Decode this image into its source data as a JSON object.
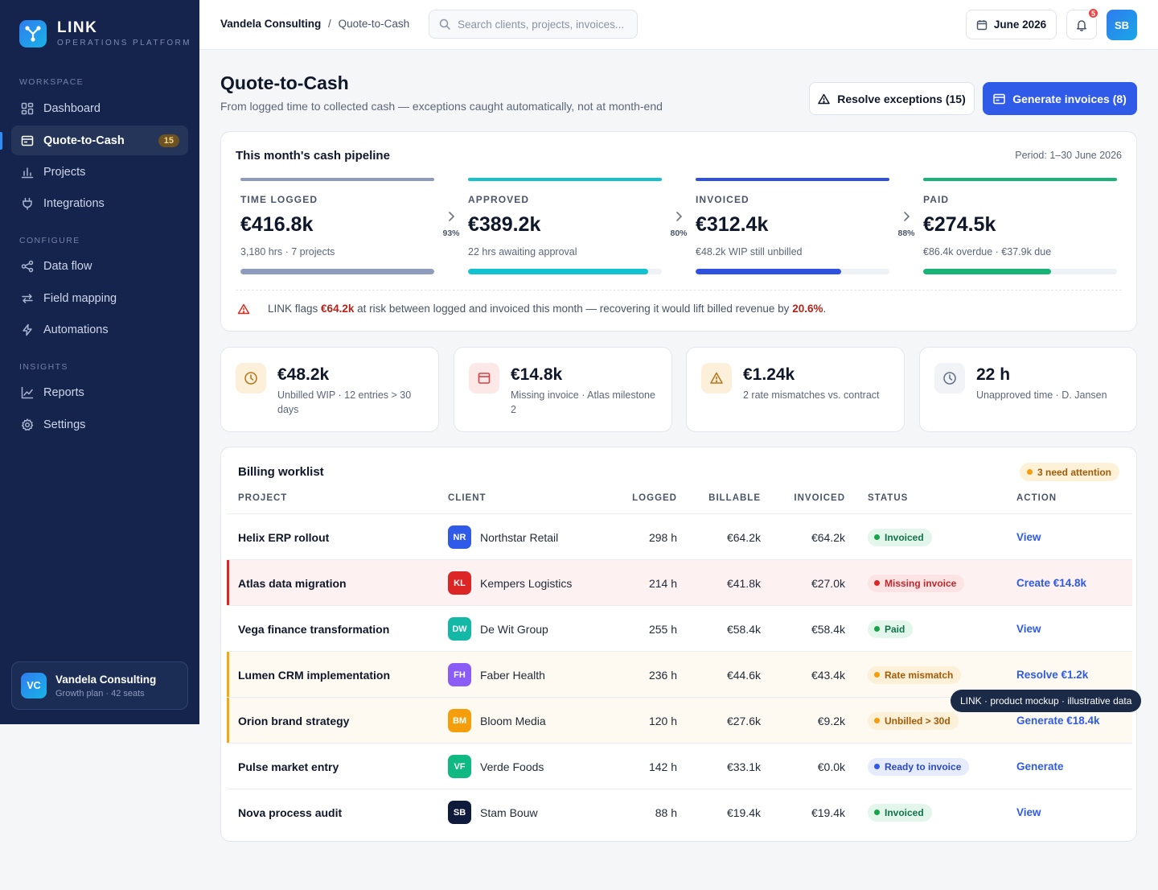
{
  "brand": {
    "title": "LINK",
    "subtitle": "OPERATIONS PLATFORM"
  },
  "sidebar": {
    "sections": [
      {
        "label": "WORKSPACE",
        "items": [
          {
            "label": "Dashboard",
            "icon": "grid-icon"
          },
          {
            "label": "Quote-to-Cash",
            "icon": "invoice-icon",
            "badge": "15",
            "active": true
          },
          {
            "label": "Projects",
            "icon": "bar-chart-icon"
          },
          {
            "label": "Integrations",
            "icon": "plug-icon"
          }
        ]
      },
      {
        "label": "CONFIGURE",
        "items": [
          {
            "label": "Data flow",
            "icon": "share-icon"
          },
          {
            "label": "Field mapping",
            "icon": "arrows-icon"
          },
          {
            "label": "Automations",
            "icon": "lightning-icon"
          }
        ]
      },
      {
        "label": "INSIGHTS",
        "items": [
          {
            "label": "Reports",
            "icon": "line-chart-icon"
          },
          {
            "label": "Settings",
            "icon": "gear-icon"
          }
        ]
      }
    ],
    "org": {
      "initials": "VC",
      "name": "Vandela Consulting",
      "plan": "Growth plan · 42 seats"
    }
  },
  "topbar": {
    "breadcrumb": {
      "org": "Vandela Consulting",
      "separator": "/",
      "page": "Quote-to-Cash"
    },
    "search_placeholder": "Search clients, projects, invoices...",
    "date": "June 2026",
    "notifications": "5",
    "user_initials": "SB"
  },
  "page": {
    "title": "Quote-to-Cash",
    "subtitle": "From logged time to collected cash — exceptions caught automatically, not at month-end",
    "resolve_button": "Resolve exceptions (15)",
    "generate_button": "Generate invoices (8)"
  },
  "pipeline": {
    "title": "This month's cash pipeline",
    "period": "Period: 1–30 June 2026",
    "stages": [
      {
        "label": "TIME LOGGED",
        "amount": "€416.8k",
        "note": "3,180 hrs · 7 projects",
        "fill": 1.0,
        "color": "#8e9bbd"
      },
      {
        "label": "APPROVED",
        "amount": "€389.2k",
        "note": "22 hrs awaiting approval",
        "fill": 0.93,
        "color": "#13c2d1"
      },
      {
        "label": "INVOICED",
        "amount": "€312.4k",
        "note": "€48.2k WIP still unbilled",
        "fill": 0.75,
        "color": "#2f51df"
      },
      {
        "label": "PAID",
        "amount": "€274.5k",
        "note": "€86.4k overdue · €37.9k due",
        "fill": 0.66,
        "color": "#17b377"
      }
    ],
    "conversions": [
      "93%",
      "80%",
      "88%"
    ],
    "risk": {
      "prefix": "LINK flags",
      "amount": "€64.2k",
      "middle": "at risk between logged and invoiced this month — recovering it would lift billed revenue by",
      "pct": "20.6%",
      "suffix": "."
    }
  },
  "stats": [
    {
      "value": "€48.2k",
      "label": "Unbilled WIP · 12 entries > 30 days",
      "icon": "clock-icon",
      "bg": "#fdf0da",
      "fg": "#b7791f"
    },
    {
      "value": "€14.8k",
      "label": "Missing invoice · Atlas milestone 2",
      "icon": "invoice-icon",
      "bg": "#fde8e8",
      "fg": "#d14343"
    },
    {
      "value": "€1.24k",
      "label": "2 rate mismatches vs. contract",
      "icon": "warning-icon",
      "bg": "#fdf0da",
      "fg": "#b7791f"
    },
    {
      "value": "22 h",
      "label": "Unapproved time · D. Jansen",
      "icon": "clock-icon",
      "bg": "#f1f3f7",
      "fg": "#64748b"
    }
  ],
  "worklist": {
    "title": "Billing worklist",
    "attention": "3 need attention",
    "columns": {
      "project": "PROJECT",
      "client": "CLIENT",
      "logged": "LOGGED",
      "billable": "BILLABLE",
      "invoiced": "INVOICED",
      "status": "STATUS",
      "action": "ACTION"
    },
    "rows": [
      {
        "project": "Helix ERP rollout",
        "initials": "NR",
        "client": "Northstar Retail",
        "avatar_color": "#2f5be8",
        "logged": "298 h",
        "billable": "€64.2k",
        "invoiced": "€64.2k",
        "status": "Invoiced",
        "status_kind": "green",
        "action": "View",
        "highlight": ""
      },
      {
        "project": "Atlas data migration",
        "initials": "KL",
        "client": "Kempers Logistics",
        "avatar_color": "#dc2626",
        "logged": "214 h",
        "billable": "€41.8k",
        "invoiced": "€27.0k",
        "status": "Missing invoice",
        "status_kind": "red",
        "action": "Create €14.8k",
        "highlight": "red"
      },
      {
        "project": "Vega finance transformation",
        "initials": "DW",
        "client": "De Wit Group",
        "avatar_color": "#14b8a6",
        "logged": "255 h",
        "billable": "€58.4k",
        "invoiced": "€58.4k",
        "status": "Paid",
        "status_kind": "green",
        "action": "View",
        "highlight": ""
      },
      {
        "project": "Lumen CRM implementation",
        "initials": "FH",
        "client": "Faber Health",
        "avatar_color": "#8b5cf6",
        "logged": "236 h",
        "billable": "€44.6k",
        "invoiced": "€43.4k",
        "status": "Rate mismatch",
        "status_kind": "amber",
        "action": "Resolve €1.2k",
        "highlight": "amber"
      },
      {
        "project": "Orion brand strategy",
        "initials": "BM",
        "client": "Bloom Media",
        "avatar_color": "#f59e0b",
        "logged": "120 h",
        "billable": "€27.6k",
        "invoiced": "€9.2k",
        "status": "Unbilled > 30d",
        "status_kind": "amber",
        "action": "Generate €18.4k",
        "highlight": "amber"
      },
      {
        "project": "Pulse market entry",
        "initials": "VF",
        "client": "Verde Foods",
        "avatar_color": "#10b981",
        "logged": "142 h",
        "billable": "€33.1k",
        "invoiced": "€0.0k",
        "status": "Ready to invoice",
        "status_kind": "blue",
        "action": "Generate",
        "highlight": ""
      },
      {
        "project": "Nova process audit",
        "initials": "SB",
        "client": "Stam Bouw",
        "avatar_color": "#0f1b3d",
        "logged": "88 h",
        "billable": "€19.4k",
        "invoiced": "€19.4k",
        "status": "Invoiced",
        "status_kind": "green",
        "action": "View",
        "highlight": ""
      }
    ]
  },
  "tooltip": "LINK · product mockup · illustrative data"
}
